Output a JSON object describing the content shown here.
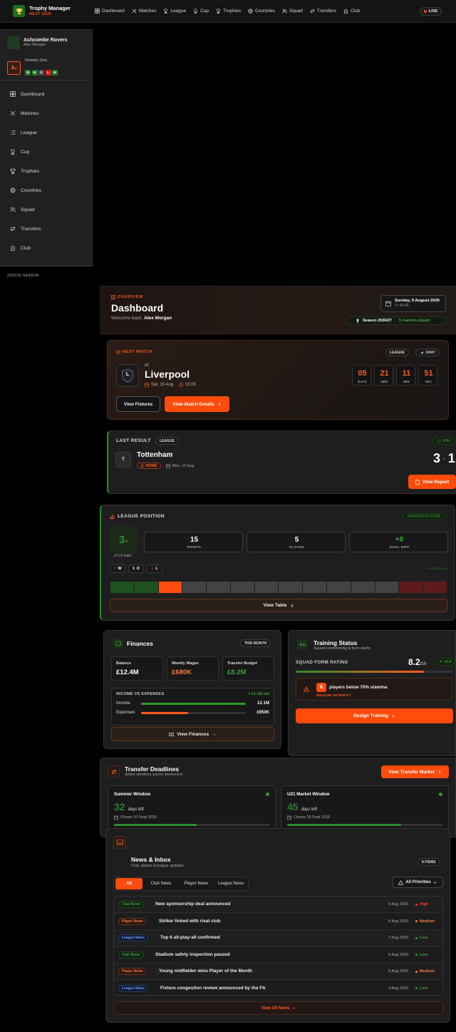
{
  "brand": {
    "title": "Trophy Manager",
    "subtitle": "NEXT GEN"
  },
  "nav": [
    "Dashboard",
    "Matches",
    "League",
    "Cup",
    "Trophies",
    "Countries",
    "Squad",
    "Transfers",
    "Club"
  ],
  "live_label": "LIVE",
  "sidebar": {
    "club_name": "Ashcombe Rovers",
    "manager": "Alex Morgan",
    "position": "3",
    "position_suffix": "rd",
    "division": "Division One",
    "form": [
      "W",
      "W",
      "D",
      "L",
      "W"
    ],
    "items": [
      "Dashboard",
      "Matches",
      "League",
      "Cup",
      "Trophies",
      "Countries",
      "Squad",
      "Transfers",
      "Club"
    ],
    "season": "2025/26 SEASON"
  },
  "overview": {
    "eyebrow": "OVERVIEW",
    "title": "Dashboard",
    "welcome": "Welcome back,",
    "user": "Alex Morgan",
    "date": "Sunday, 9 August 2026",
    "time": "17:46:00",
    "season": "Season 2026/27",
    "matches_played": "5 matches played"
  },
  "next_match": {
    "eyebrow": "NEXT MATCH",
    "comp": "LEAGUE",
    "venue": "AWAY",
    "at": "AT",
    "opponent": "Liverpool",
    "crest_letter": "L",
    "date": "Sat, 15 Aug",
    "time": "15:00",
    "countdown": [
      {
        "value": "05",
        "label": "DAYS"
      },
      {
        "value": "21",
        "label": "HRS"
      },
      {
        "value": "11",
        "label": "MIN"
      },
      {
        "value": "51",
        "label": "SEC"
      }
    ],
    "fixtures_btn": "View Fixtures",
    "details_btn": "View Match Details"
  },
  "last_result": {
    "title": "LAST RESULT",
    "comp": "LEAGUE",
    "outcome": "WIN",
    "opponent": "Tottenham",
    "crest_letter": "T",
    "venue": "HOME",
    "date": "Mon, 10 Aug",
    "score_home": "3",
    "score_sep": "-",
    "score_away": "1",
    "report_btn": "View Report"
  },
  "league": {
    "title": "LEAGUE POSITION",
    "zone": "PROMOTION ZONE",
    "position": "3",
    "position_suffix": "rd",
    "of_clubs": "of 14 clubs",
    "stats": [
      {
        "value": "15",
        "label": "POINTS"
      },
      {
        "value": "5",
        "label": "PLAYED"
      },
      {
        "value": "+8",
        "label": "GOAL DIFF"
      }
    ],
    "record": [
      {
        "n": "3",
        "k": "W"
      },
      {
        "n": "1",
        "k": "D"
      },
      {
        "n": "1",
        "k": "L"
      }
    ],
    "record_note": "+8 GD/season",
    "table_btn": "View Table",
    "colors": {
      "promotion": "#1d5a1f",
      "current": "#ff4c0c",
      "mid": "#4a4a4a",
      "relegation": "#6a1a1a"
    }
  },
  "finances": {
    "title": "Finances",
    "period": "THIS MONTH",
    "cards": [
      {
        "label": "Balance",
        "value": "£12.4M"
      },
      {
        "label": "Weekly Wages",
        "value": "£680K"
      },
      {
        "label": "Transfer Budget",
        "value": "£8.2M"
      }
    ],
    "ivx_title": "INCOME VS EXPENSES",
    "net": "£1.1M net",
    "income_label": "Income",
    "income_value": "£2.1M",
    "income_pct": 100,
    "expenses_label": "Expenses",
    "expenses_value": "£950K",
    "expenses_pct": 45,
    "btn": "View Finances"
  },
  "training": {
    "title": "Training Status",
    "subtitle": "Squad conditioning & form alerts",
    "rating_label": "SQUAD FORM RATING",
    "rating": "8.2",
    "rating_max": "/10",
    "rating_pct": 82,
    "trend": "+0.4",
    "alert_count": "6",
    "alert_text": "players below 70% stamina",
    "severity": "MEDIUM SEVERITY",
    "btn": "Design Training"
  },
  "transfers": {
    "title": "Transfer Deadlines",
    "subtitle": "Active windows you're involved in",
    "btn": "View Transfer Market",
    "windows": [
      {
        "name": "Summer Window",
        "days": "32",
        "days_label": "days left",
        "closes": "Closes 10 Sept 2026",
        "progress": 0.53
      },
      {
        "name": "U21 Market Window",
        "days": "45",
        "days_label": "days left",
        "closes": "Closes 23 Sept 2026",
        "progress": 0.73
      }
    ]
  },
  "news": {
    "title": "News & Inbox",
    "subtitle": "Club, player & league updates",
    "count": "8 ITEMS",
    "tabs": [
      "All",
      "Club News",
      "Player News",
      "League News"
    ],
    "priority_filter": "All Priorities",
    "items": [
      {
        "tag": "Club News",
        "type": "club",
        "headline": "New sponsorship deal announced",
        "date": "9 Aug 2026",
        "priority": "High"
      },
      {
        "tag": "Player News",
        "type": "player",
        "headline": "Striker linked with rival club",
        "date": "8 Aug 2026",
        "priority": "Medium"
      },
      {
        "tag": "League News",
        "type": "league",
        "headline": "Top 6 all-play-all confirmed",
        "date": "7 Aug 2026",
        "priority": "Low"
      },
      {
        "tag": "Club News",
        "type": "club",
        "headline": "Stadium safety inspection passed",
        "date": "6 Aug 2026",
        "priority": "Low"
      },
      {
        "tag": "Player News",
        "type": "player",
        "headline": "Young midfielder wins Player of the Month",
        "date": "5 Aug 2026",
        "priority": "Medium"
      },
      {
        "tag": "League News",
        "type": "league",
        "headline": "Fixture congestion review announced by the FA",
        "date": "4 Aug 2026",
        "priority": "Low"
      }
    ],
    "view_all": "View All News"
  }
}
